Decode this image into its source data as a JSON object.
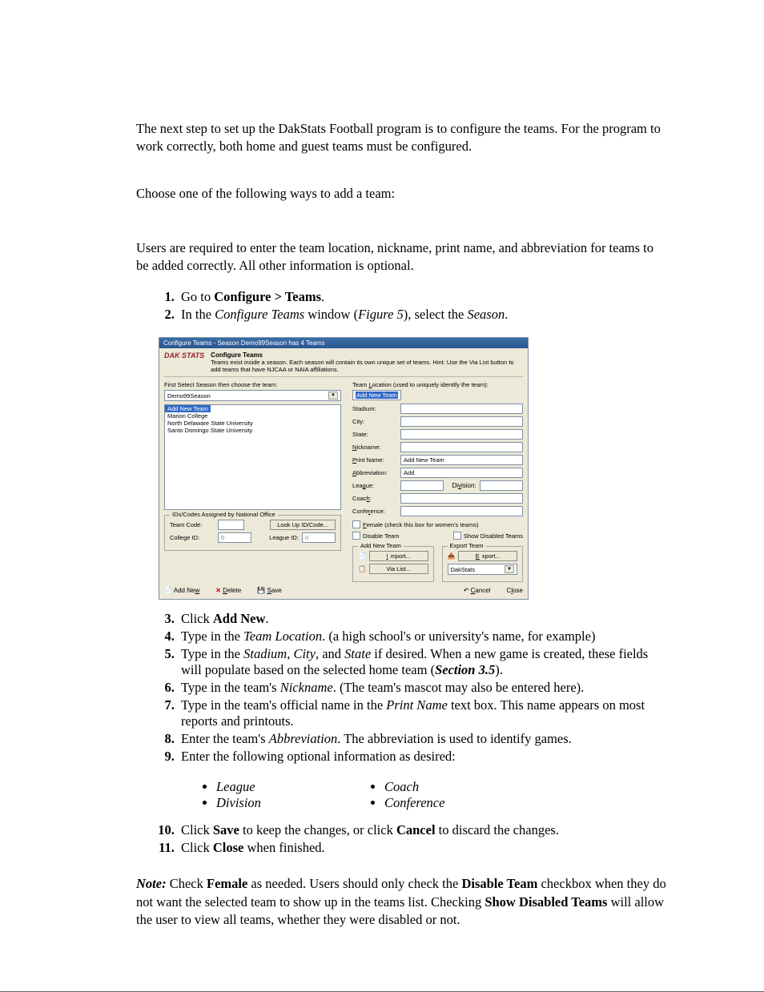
{
  "intro1": "The next step to set up the DakStats Football program is to configure the teams. For the program to work correctly, both home and guest teams must be configured.",
  "intro2": "Choose one of the following ways to add a team:",
  "intro3": "Users are required to enter the team location, nickname, print name, and abbreviation for teams to be added correctly. All other information is optional.",
  "steps12": {
    "s1a": "Go to ",
    "s1b": "Configure > Teams",
    "s1c": ".",
    "s2a": "In the ",
    "s2b": "Configure Teams",
    "s2c": " window (",
    "s2d": "Figure 5",
    "s2e": "), select the ",
    "s2f": "Season",
    "s2g": "."
  },
  "fig": {
    "title": "Configure Teams - Season Demo99Season has 4 Teams",
    "logo": "DAK STATS",
    "bannerHeading": "Configure Teams",
    "bannerText": "Teams exist inside a season. Each season will contain its own unique set of teams. Hint: Use the Via List button to add teams that have NJCAA or NAIA affiliations.",
    "leftLabel": "First Select Season then choose the team:",
    "season": "Demo99Season",
    "teams": {
      "sel": "Add New Team",
      "t1": "Marion College",
      "t2": "North Delaware State University",
      "t3": "Santo Domingo State University"
    },
    "rightLabel": "Team Location (used to uniquely identify the team):",
    "locVal": "Add New Team",
    "fields": {
      "stadium": "Stadium:",
      "city": "City:",
      "state": "State:",
      "nickname": "Nickname:",
      "printname": "Print Name:",
      "printnameVal": "Add New Team",
      "abbrev": "Abbreviation:",
      "abbrevVal": "Add",
      "league": "League:",
      "division": "Division:",
      "coach": "Coach:",
      "conference": "Conference:"
    },
    "chkFemale": "Female (check this box for women's teams)",
    "chkDisable": "Disable Team",
    "chkShowDisabled": "Show Disabled Teams",
    "ids": {
      "grp": "IDs/Codes Assigned by National Office",
      "teamcode": "Team Code:",
      "lookup": "Look Up ID/Code...",
      "collegeid": "College ID:",
      "leagueid": "League ID:",
      "zero": "0"
    },
    "addgrp": "Add New Team",
    "exportgrp": "Export Team",
    "import": "Import...",
    "vialist": "Via List...",
    "export": "Export...",
    "dakstats": "DakStats",
    "addnew": "Add New",
    "delete": "Delete",
    "save": "Save",
    "cancel": "Cancel",
    "close": "Close"
  },
  "steps3_11": {
    "s3a": "Click ",
    "s3b": "Add New",
    "s3c": ".",
    "s4a": "Type in the ",
    "s4b": "Team Location",
    "s4c": ". (a high school's or university's name, for example)",
    "s5a": "Type in the ",
    "s5b": "Stadium",
    "s5c": ", ",
    "s5d": "City",
    "s5e": ", and ",
    "s5f": "State",
    "s5g": " if desired. When a new game is created, these fields will populate based on the selected home team (",
    "s5h": "Section 3.5",
    "s5i": ").",
    "s6a": "Type in the team's ",
    "s6b": "Nickname",
    "s6c": ". (The team's mascot may also be entered here).",
    "s7a": "Type in the team's official name in the ",
    "s7b": "Print Name",
    "s7c": " text box. This name appears on most reports and printouts.",
    "s8a": "Enter the team's ",
    "s8b": "Abbreviation",
    "s8c": ". The abbreviation is used to identify games.",
    "s9": "Enter the following optional information as desired:",
    "s10a": "Click ",
    "s10b": "Save",
    "s10c": " to keep the changes, or click ",
    "s10d": "Cancel",
    "s10e": " to discard the changes.",
    "s11a": "Click ",
    "s11b": "Close",
    "s11c": " when finished."
  },
  "opts": {
    "o1": "League",
    "o2": "Division",
    "o3": "Coach",
    "o4": "Conference"
  },
  "note": {
    "a": "Note:",
    "b": " Check ",
    "c": "Female",
    "d": " as needed. Users should only check the ",
    "e": "Disable Team",
    "f": " checkbox when they do not want the selected team to show up in the teams list. Checking ",
    "g": "Show Disabled Teams",
    "h": " will allow the user to view all teams, whether they were disabled or not."
  }
}
